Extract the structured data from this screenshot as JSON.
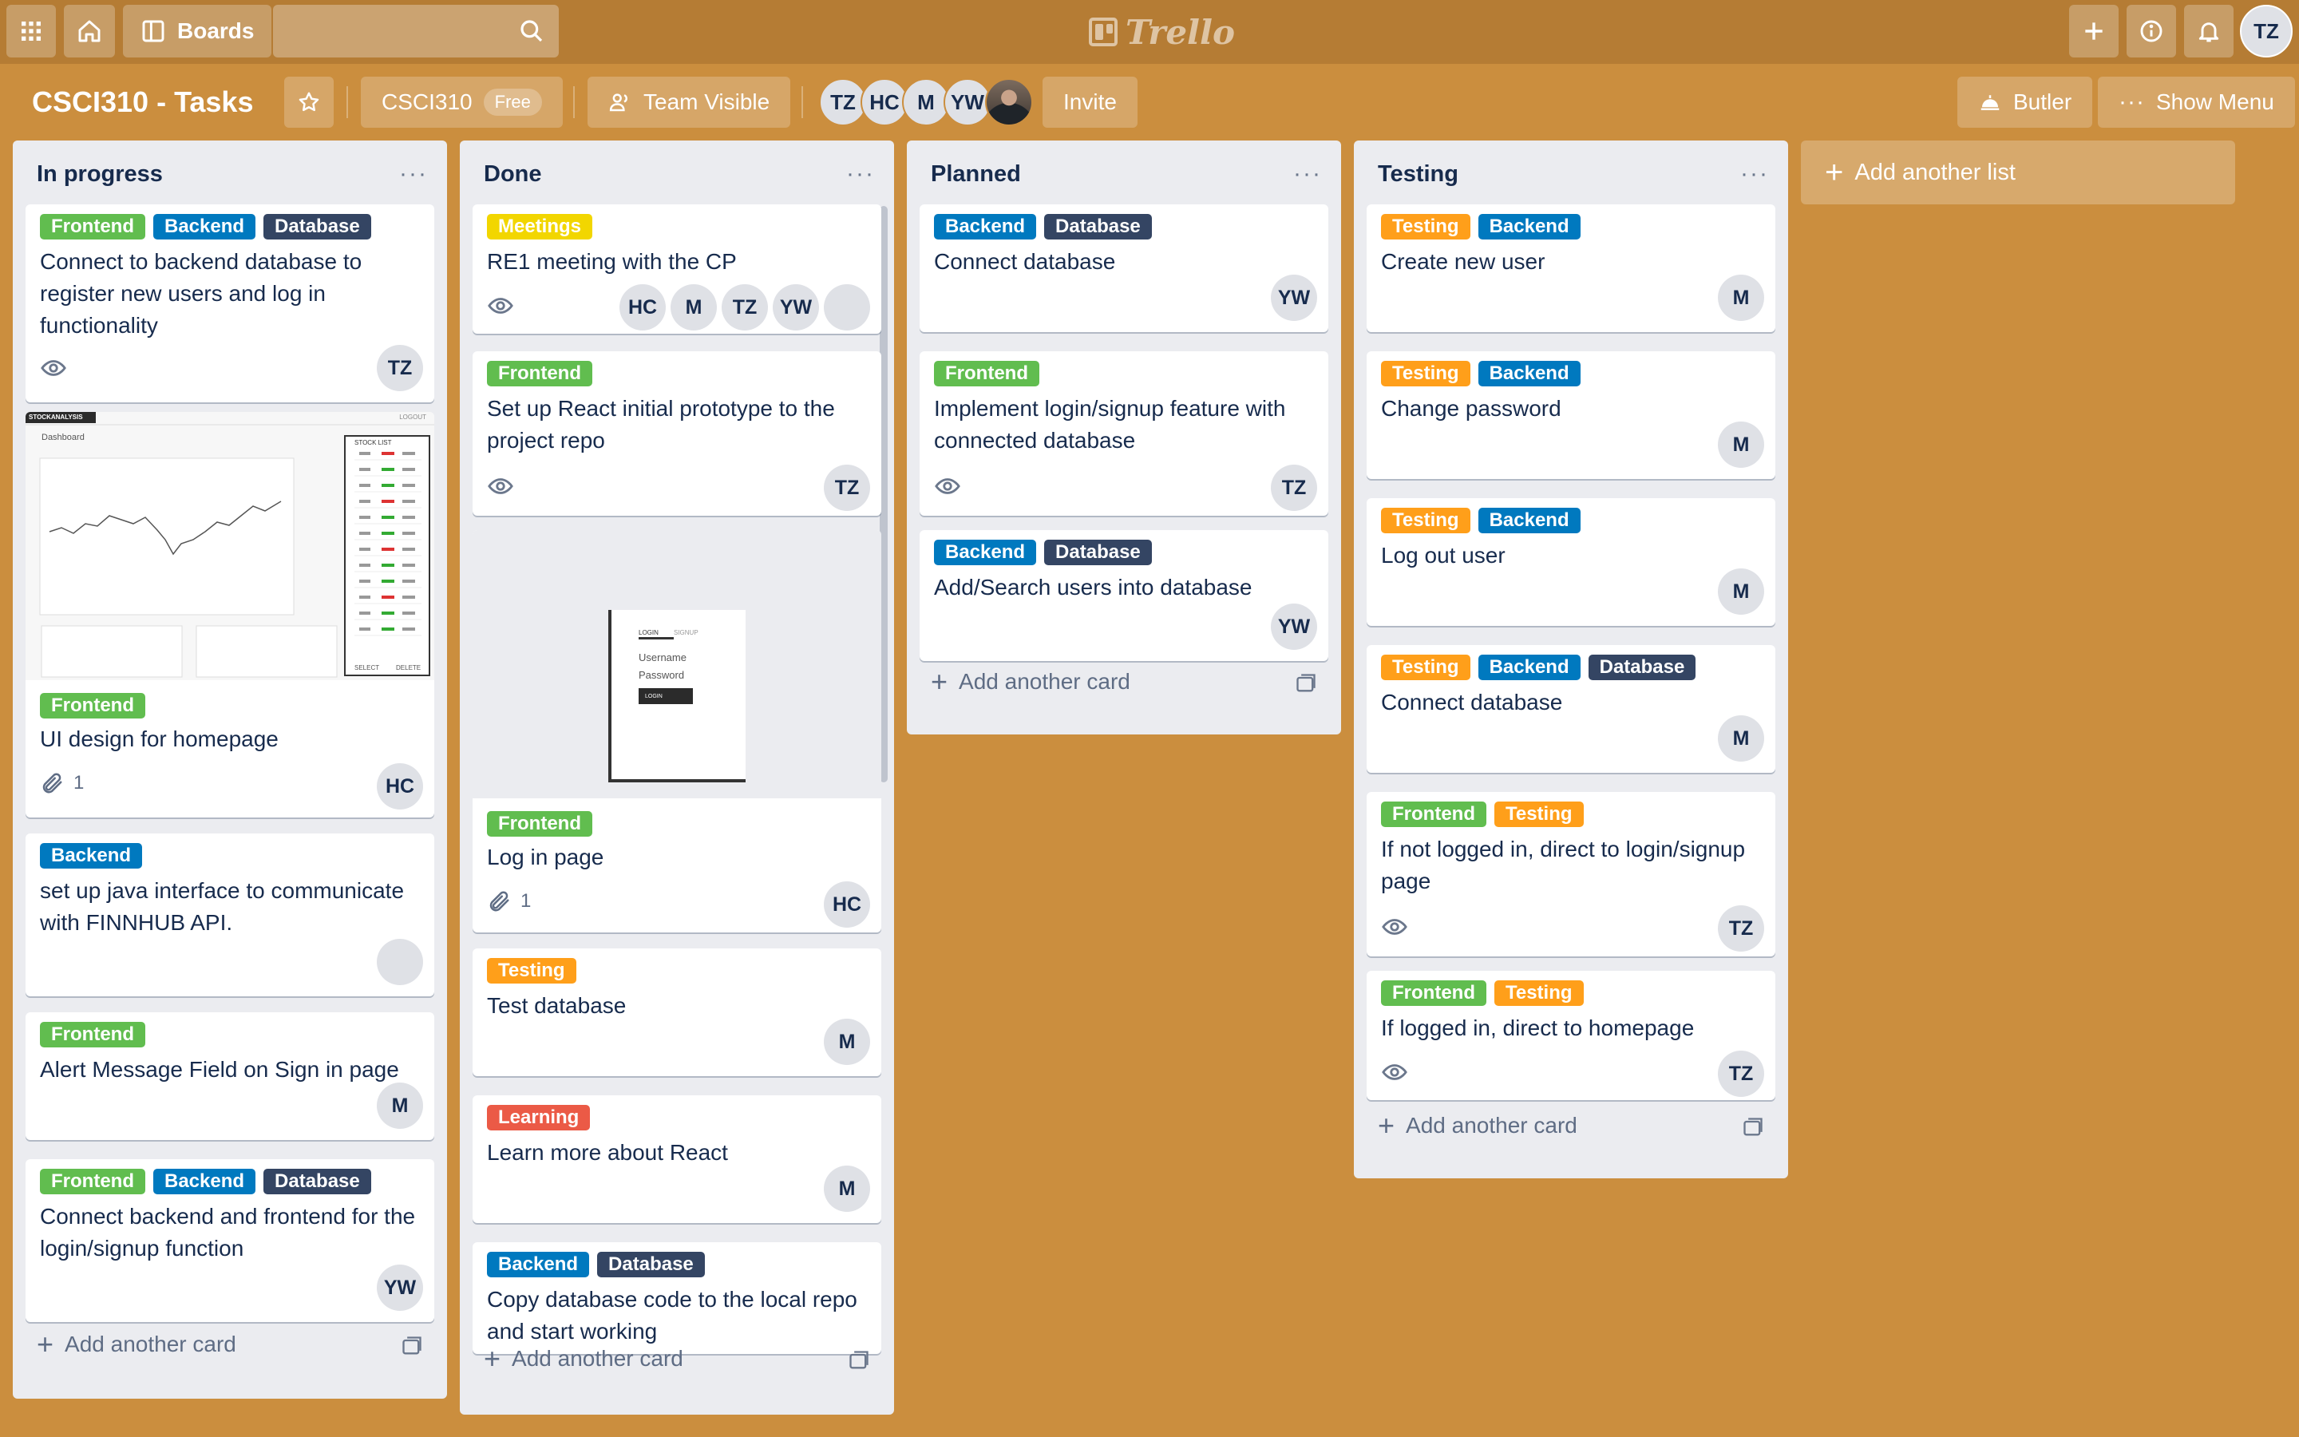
{
  "topbar": {
    "boards_label": "Boards",
    "logo_text": "Trello",
    "user_initials": "TZ"
  },
  "board": {
    "title": "CSCI310 - Tasks",
    "team_name": "CSCI310",
    "plan": "Free",
    "visibility": "Team Visible",
    "members": [
      "TZ",
      "HC",
      "M",
      "YW"
    ],
    "invite_label": "Invite",
    "butler_label": "Butler",
    "show_menu_label": "Show Menu",
    "add_list_label": "Add another list"
  },
  "label_colors": {
    "Frontend": "#61bd4f",
    "Backend": "#0079bf",
    "Database": "#344563",
    "Testing": "#ff9f1a",
    "Meetings": "#f2d600",
    "Learning": "#eb5a46"
  },
  "lists": [
    {
      "title": "In progress",
      "add_card_label": "Add another card",
      "cards": [
        {
          "labels": [
            "Frontend",
            "Backend",
            "Database"
          ],
          "title": "Connect to backend database to register new users and log in functionality",
          "members": [
            "TZ"
          ],
          "watching": true
        },
        {
          "labels": [
            "Frontend"
          ],
          "title": "UI design for homepage",
          "members": [
            "HC"
          ],
          "attachments": "1",
          "cover": {
            "brand": "STOCKANALYSIS",
            "logout": "LOGOUT",
            "heading": "Dashboard",
            "stock_list": "STOCK LIST",
            "select": "SELECT",
            "delete": "DELETE"
          }
        },
        {
          "labels": [
            "Backend"
          ],
          "title": "set up java interface to communicate with FINNHUB API.",
          "members": [
            "photo"
          ]
        },
        {
          "labels": [
            "Frontend"
          ],
          "title": "Alert Message Field on Sign in page",
          "members": [
            "M"
          ]
        },
        {
          "labels": [
            "Frontend",
            "Backend",
            "Database"
          ],
          "title": "Connect backend and frontend for the login/signup function",
          "members": [
            "YW"
          ]
        }
      ]
    },
    {
      "title": "Done",
      "add_card_label": "Add another card",
      "cards": [
        {
          "labels": [
            "Meetings"
          ],
          "title": "RE1 meeting with the CP",
          "members": [
            "HC",
            "M",
            "TZ",
            "YW",
            "photo"
          ],
          "watching": true
        },
        {
          "labels": [
            "Frontend"
          ],
          "title": "Set up React initial prototype to the project repo",
          "members": [
            "TZ"
          ],
          "watching": true
        },
        {
          "labels": [
            "Frontend"
          ],
          "title": "Log in page",
          "members": [
            "HC"
          ],
          "attachments": "1",
          "cover": {
            "tab_login": "LOGIN",
            "tab_signup": "SIGNUP",
            "username": "Username",
            "password": "Password",
            "button": "LOGIN"
          }
        },
        {
          "labels": [
            "Testing"
          ],
          "title": "Test database",
          "members": [
            "M"
          ]
        },
        {
          "labels": [
            "Learning"
          ],
          "title": "Learn more about React",
          "members": [
            "M"
          ]
        },
        {
          "labels": [
            "Backend",
            "Database"
          ],
          "title": "Copy database code to the local repo and start working",
          "members": []
        }
      ]
    },
    {
      "title": "Planned",
      "add_card_label": "Add another card",
      "cards": [
        {
          "labels": [
            "Backend",
            "Database"
          ],
          "title": "Connect database",
          "members": [
            "YW"
          ]
        },
        {
          "labels": [
            "Frontend"
          ],
          "title": "Implement login/signup feature with connected database",
          "members": [
            "TZ"
          ],
          "watching": true
        },
        {
          "labels": [
            "Backend",
            "Database"
          ],
          "title": "Add/Search users into database",
          "members": [
            "YW"
          ]
        }
      ]
    },
    {
      "title": "Testing",
      "add_card_label": "Add another card",
      "cards": [
        {
          "labels": [
            "Testing",
            "Backend"
          ],
          "title": "Create new user",
          "members": [
            "M"
          ]
        },
        {
          "labels": [
            "Testing",
            "Backend"
          ],
          "title": "Change password",
          "members": [
            "M"
          ]
        },
        {
          "labels": [
            "Testing",
            "Backend"
          ],
          "title": "Log out user",
          "members": [
            "M"
          ]
        },
        {
          "labels": [
            "Testing",
            "Backend",
            "Database"
          ],
          "title": "Connect database",
          "members": [
            "M"
          ]
        },
        {
          "labels": [
            "Frontend",
            "Testing"
          ],
          "title": "If not logged in, direct to login/signup page",
          "members": [
            "TZ"
          ],
          "watching": true
        },
        {
          "labels": [
            "Frontend",
            "Testing"
          ],
          "title": "If logged in, direct to homepage",
          "members": [
            "TZ"
          ],
          "watching": true
        }
      ]
    }
  ]
}
